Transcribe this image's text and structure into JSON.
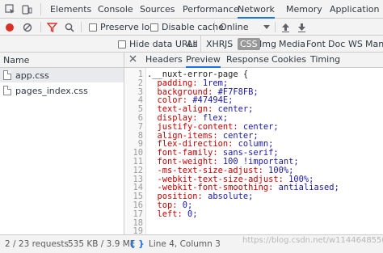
{
  "tabs": [
    "Elements",
    "Console",
    "Sources",
    "Performance",
    "Network",
    "Memory",
    "Application"
  ],
  "toolbar": {
    "preserve_log": "Preserve log",
    "disable_cache": "Disable cache",
    "throttle": "Online"
  },
  "filter": {
    "hide_data_urls": "Hide data URLs",
    "types": [
      "All",
      "XHR",
      "JS",
      "CSS",
      "Img",
      "Media",
      "Font",
      "Doc",
      "WS",
      "Manif"
    ],
    "selected_type": "CSS"
  },
  "requests": {
    "header": "Name",
    "files": [
      "app.css",
      "pages_index.css"
    ]
  },
  "detail_tabs": [
    "Headers",
    "Preview",
    "Response",
    "Cookies",
    "Timing"
  ],
  "code_lines": [
    {
      "n": "1",
      "sel": ".__nuxt-error-page {",
      "prop": "",
      "val": ""
    },
    {
      "n": "2",
      "sel": "",
      "prop": "  padding:",
      "val": " 1rem;"
    },
    {
      "n": "3",
      "sel": "",
      "prop": "  background:",
      "val": " #F7F8FB;"
    },
    {
      "n": "4",
      "sel": "",
      "prop": "  color:",
      "val": " #47494E;"
    },
    {
      "n": "5",
      "sel": "",
      "prop": "  text-align:",
      "val": " center;"
    },
    {
      "n": "6",
      "sel": "",
      "prop": "  display:",
      "val": " flex;"
    },
    {
      "n": "7",
      "sel": "",
      "prop": "  justify-content:",
      "val": " center;"
    },
    {
      "n": "8",
      "sel": "",
      "prop": "  align-items:",
      "val": " center;"
    },
    {
      "n": "9",
      "sel": "",
      "prop": "  flex-direction:",
      "val": " column;"
    },
    {
      "n": "10",
      "sel": "",
      "prop": "  font-family:",
      "val": " sans-serif;"
    },
    {
      "n": "11",
      "sel": "",
      "prop": "  font-weight:",
      "val": " 100 !important;"
    },
    {
      "n": "12",
      "sel": "",
      "prop": "  -ms-text-size-adjust:",
      "val": " 100%;"
    },
    {
      "n": "13",
      "sel": "",
      "prop": "  -webkit-text-size-adjust:",
      "val": " 100%;"
    },
    {
      "n": "14",
      "sel": "",
      "prop": "  -webkit-font-smoothing:",
      "val": " antialiased;"
    },
    {
      "n": "15",
      "sel": "",
      "prop": "  position:",
      "val": " absolute;"
    },
    {
      "n": "16",
      "sel": "",
      "prop": "  top:",
      "val": " 0;"
    },
    {
      "n": "17",
      "sel": "",
      "prop": "  left:",
      "val": " 0;"
    },
    {
      "n": "18",
      "sel": "",
      "prop": "",
      "val": ""
    },
    {
      "n": "19",
      "sel": "",
      "prop": "",
      "val": ""
    }
  ],
  "status": {
    "requests": "2 / 23 requests",
    "size": "535 KB / 3.9 ME",
    "cursor": "Line 4, Column 3",
    "format_glyph": "{ }",
    "watermark": "https://blog.csdn.net/w1144648550"
  },
  "colors": {
    "accent": "#1a73e8",
    "record": "#d93025",
    "filter_funnel": "#d93025",
    "css_property": "#c80000",
    "css_value": "#1a1aa6"
  }
}
